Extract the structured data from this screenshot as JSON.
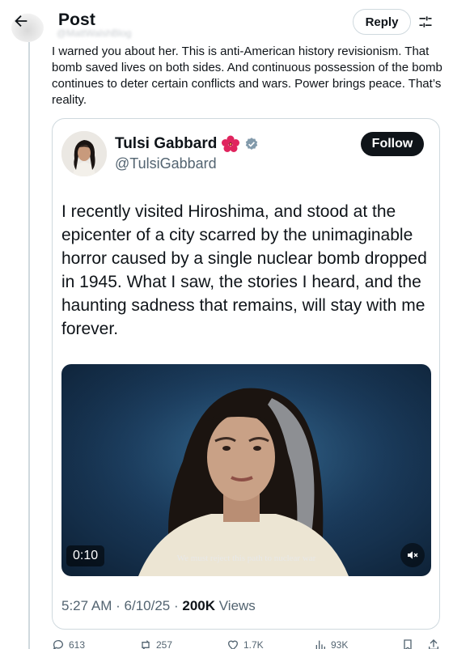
{
  "header": {
    "title": "Post",
    "reply_label": "Reply",
    "blurred_handle": "@MattWalshBlog"
  },
  "reply": {
    "text": "I warned you about her. This is anti-American history revisionism. That bomb saved lives on both sides. And continuous possession of the bomb continues to deter certain conflicts and wars. Power brings peace. That’s reality."
  },
  "quote": {
    "name": "Tulsi Gabbard",
    "handle": "@TulsiGabbard",
    "follow_label": "Follow",
    "text": "I recently visited Hiroshima, and stood at the epicenter of a city scarred by the unimaginable horror caused by a single nuclear bomb dropped in 1945. What I saw, the stories I heard, and the haunting sadness that remains, will stay with me forever.",
    "video": {
      "duration": "0:10",
      "caption": "We must reject this path to nuclear war"
    },
    "time": "5:27 AM",
    "date": "6/10/25",
    "views_count": "200K",
    "views_label": "Views",
    "separator": "·"
  },
  "actions": {
    "replies": "613",
    "reposts": "257",
    "likes": "1.7K",
    "views": "93K"
  },
  "colors": {
    "text": "#0f1419",
    "secondary": "#536471",
    "border": "#cfd9de",
    "verified": "#829aab"
  }
}
